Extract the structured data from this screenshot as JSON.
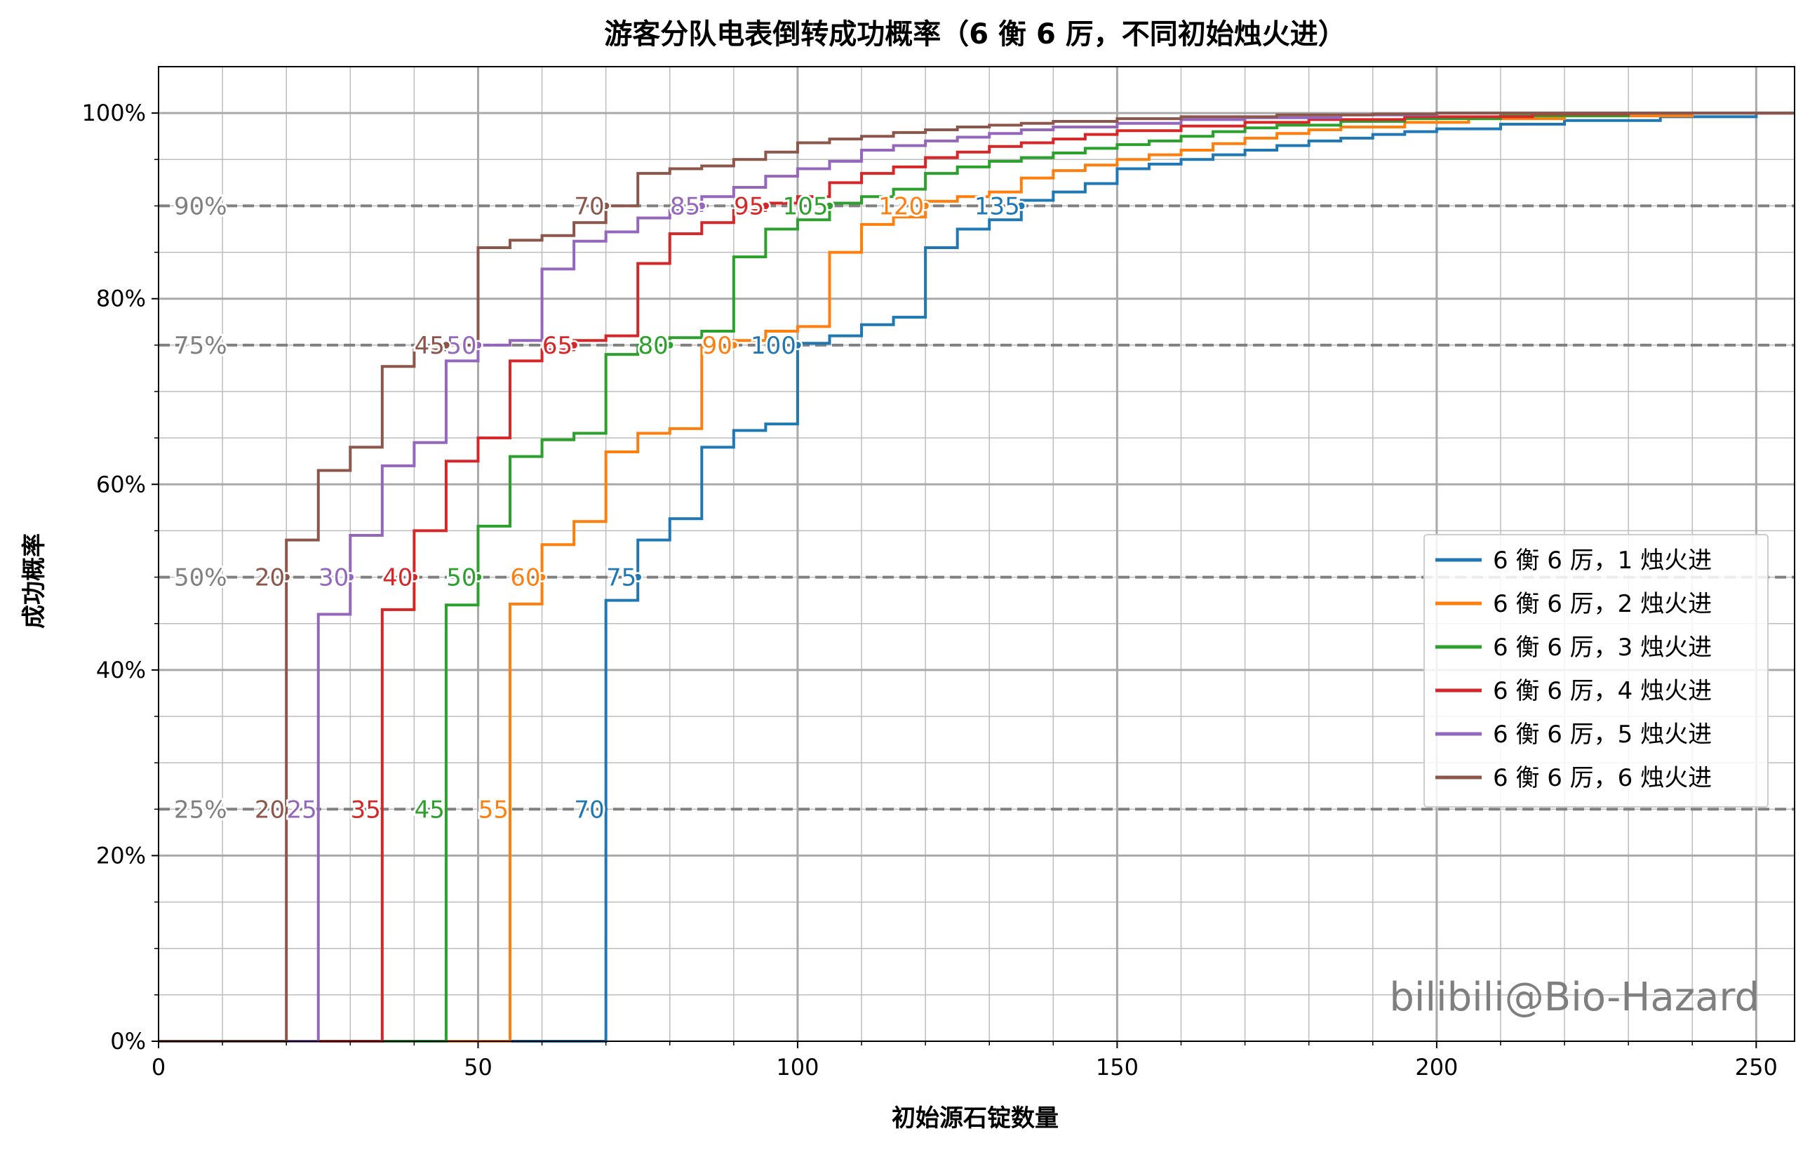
{
  "chart_data": {
    "type": "line",
    "step": "post",
    "title": "游客分队电表倒转成功概率（6 衡 6 厉，不同初始烛火进）",
    "xlabel": "初始源石锭数量",
    "ylabel": "成功概率",
    "xlim": [
      0,
      256
    ],
    "ylim": [
      0,
      1.05
    ],
    "x_ticks": [
      0,
      50,
      100,
      150,
      200,
      250
    ],
    "y_ticks": [
      0,
      0.2,
      0.4,
      0.6,
      0.8,
      1.0
    ],
    "x_tick_labels": [
      "0",
      "50",
      "100",
      "150",
      "200",
      "250"
    ],
    "y_tick_labels": [
      "0%",
      "20%",
      "40%",
      "60%",
      "80%",
      "100%"
    ],
    "grid": true,
    "legend_position": "center-right",
    "reference_lines": [
      {
        "y": 0.25,
        "label": "25%"
      },
      {
        "y": 0.5,
        "label": "50%"
      },
      {
        "y": 0.75,
        "label": "75%"
      },
      {
        "y": 0.9,
        "label": "90%"
      }
    ],
    "series": [
      {
        "name": "6 衡 6 厉，1 烛火进",
        "color": "#1f77b4",
        "steps": [
          [
            0,
            0
          ],
          [
            70,
            0.475
          ],
          [
            75,
            0.54
          ],
          [
            80,
            0.563
          ],
          [
            85,
            0.64
          ],
          [
            90,
            0.658
          ],
          [
            95,
            0.665
          ],
          [
            100,
            0.752
          ],
          [
            105,
            0.76
          ],
          [
            110,
            0.772
          ],
          [
            115,
            0.78
          ],
          [
            120,
            0.855
          ],
          [
            125,
            0.875
          ],
          [
            130,
            0.885
          ],
          [
            135,
            0.906
          ],
          [
            140,
            0.915
          ],
          [
            145,
            0.924
          ],
          [
            150,
            0.94
          ],
          [
            155,
            0.945
          ],
          [
            160,
            0.95
          ],
          [
            165,
            0.955
          ],
          [
            170,
            0.96
          ],
          [
            175,
            0.965
          ],
          [
            180,
            0.97
          ],
          [
            185,
            0.973
          ],
          [
            190,
            0.977
          ],
          [
            195,
            0.98
          ],
          [
            200,
            0.983
          ],
          [
            210,
            0.988
          ],
          [
            220,
            0.992
          ],
          [
            235,
            0.996
          ],
          [
            250,
            1.0
          ],
          [
            256,
            1.0
          ]
        ],
        "markers": [
          {
            "x": 70,
            "y": 0.25,
            "label": "70"
          },
          {
            "x": 75,
            "y": 0.5,
            "label": "75"
          },
          {
            "x": 100,
            "y": 0.75,
            "label": "100"
          },
          {
            "x": 135,
            "y": 0.9,
            "label": "135"
          }
        ]
      },
      {
        "name": "6 衡 6 厉，2 烛火进",
        "color": "#ff7f0e",
        "steps": [
          [
            0,
            0
          ],
          [
            55,
            0.471
          ],
          [
            60,
            0.535
          ],
          [
            65,
            0.56
          ],
          [
            70,
            0.635
          ],
          [
            75,
            0.655
          ],
          [
            80,
            0.66
          ],
          [
            85,
            0.748
          ],
          [
            90,
            0.755
          ],
          [
            95,
            0.765
          ],
          [
            100,
            0.77
          ],
          [
            105,
            0.85
          ],
          [
            110,
            0.88
          ],
          [
            115,
            0.888
          ],
          [
            120,
            0.905
          ],
          [
            125,
            0.91
          ],
          [
            130,
            0.915
          ],
          [
            135,
            0.93
          ],
          [
            140,
            0.938
          ],
          [
            145,
            0.944
          ],
          [
            150,
            0.95
          ],
          [
            155,
            0.955
          ],
          [
            160,
            0.96
          ],
          [
            165,
            0.967
          ],
          [
            170,
            0.973
          ],
          [
            175,
            0.978
          ],
          [
            180,
            0.982
          ],
          [
            185,
            0.985
          ],
          [
            195,
            0.99
          ],
          [
            205,
            0.994
          ],
          [
            220,
            0.997
          ],
          [
            240,
            1.0
          ],
          [
            256,
            1.0
          ]
        ],
        "markers": [
          {
            "x": 55,
            "y": 0.25,
            "label": "55"
          },
          {
            "x": 60,
            "y": 0.5,
            "label": "60"
          },
          {
            "x": 90,
            "y": 0.75,
            "label": "90"
          },
          {
            "x": 120,
            "y": 0.9,
            "label": "120"
          }
        ]
      },
      {
        "name": "6 衡 6 厉，3 烛火进",
        "color": "#2ca02c",
        "steps": [
          [
            0,
            0
          ],
          [
            45,
            0.47
          ],
          [
            50,
            0.555
          ],
          [
            55,
            0.63
          ],
          [
            60,
            0.648
          ],
          [
            65,
            0.655
          ],
          [
            70,
            0.74
          ],
          [
            75,
            0.75
          ],
          [
            80,
            0.758
          ],
          [
            85,
            0.765
          ],
          [
            90,
            0.845
          ],
          [
            95,
            0.875
          ],
          [
            100,
            0.885
          ],
          [
            105,
            0.903
          ],
          [
            110,
            0.91
          ],
          [
            115,
            0.918
          ],
          [
            120,
            0.935
          ],
          [
            125,
            0.942
          ],
          [
            130,
            0.948
          ],
          [
            135,
            0.952
          ],
          [
            140,
            0.957
          ],
          [
            145,
            0.962
          ],
          [
            150,
            0.966
          ],
          [
            155,
            0.97
          ],
          [
            160,
            0.975
          ],
          [
            165,
            0.98
          ],
          [
            170,
            0.984
          ],
          [
            175,
            0.987
          ],
          [
            185,
            0.991
          ],
          [
            195,
            0.994
          ],
          [
            210,
            0.997
          ],
          [
            230,
            1.0
          ],
          [
            256,
            1.0
          ]
        ],
        "markers": [
          {
            "x": 45,
            "y": 0.25,
            "label": "45"
          },
          {
            "x": 50,
            "y": 0.5,
            "label": "50"
          },
          {
            "x": 80,
            "y": 0.75,
            "label": "80"
          },
          {
            "x": 105,
            "y": 0.9,
            "label": "105"
          }
        ]
      },
      {
        "name": "6 衡 6 厉，4 烛火进",
        "color": "#d62728",
        "steps": [
          [
            0,
            0
          ],
          [
            35,
            0.465
          ],
          [
            40,
            0.55
          ],
          [
            45,
            0.625
          ],
          [
            50,
            0.65
          ],
          [
            55,
            0.733
          ],
          [
            60,
            0.745
          ],
          [
            65,
            0.755
          ],
          [
            70,
            0.76
          ],
          [
            75,
            0.838
          ],
          [
            80,
            0.87
          ],
          [
            85,
            0.882
          ],
          [
            90,
            0.895
          ],
          [
            95,
            0.903
          ],
          [
            100,
            0.91
          ],
          [
            105,
            0.925
          ],
          [
            110,
            0.935
          ],
          [
            115,
            0.942
          ],
          [
            120,
            0.952
          ],
          [
            125,
            0.958
          ],
          [
            130,
            0.964
          ],
          [
            135,
            0.968
          ],
          [
            140,
            0.972
          ],
          [
            145,
            0.977
          ],
          [
            150,
            0.981
          ],
          [
            160,
            0.986
          ],
          [
            170,
            0.99
          ],
          [
            180,
            0.993
          ],
          [
            195,
            0.996
          ],
          [
            215,
            0.999
          ],
          [
            230,
            1.0
          ],
          [
            256,
            1.0
          ]
        ],
        "markers": [
          {
            "x": 35,
            "y": 0.25,
            "label": "35"
          },
          {
            "x": 40,
            "y": 0.5,
            "label": "40"
          },
          {
            "x": 65,
            "y": 0.75,
            "label": "65"
          },
          {
            "x": 95,
            "y": 0.9,
            "label": "95"
          }
        ]
      },
      {
        "name": "6 衡 6 厉，5 烛火进",
        "color": "#9467bd",
        "steps": [
          [
            0,
            0
          ],
          [
            25,
            0.46
          ],
          [
            30,
            0.545
          ],
          [
            35,
            0.62
          ],
          [
            40,
            0.645
          ],
          [
            45,
            0.733
          ],
          [
            50,
            0.75
          ],
          [
            55,
            0.755
          ],
          [
            60,
            0.832
          ],
          [
            65,
            0.862
          ],
          [
            70,
            0.872
          ],
          [
            75,
            0.887
          ],
          [
            80,
            0.895
          ],
          [
            85,
            0.91
          ],
          [
            90,
            0.92
          ],
          [
            95,
            0.932
          ],
          [
            100,
            0.94
          ],
          [
            105,
            0.948
          ],
          [
            110,
            0.96
          ],
          [
            115,
            0.965
          ],
          [
            120,
            0.97
          ],
          [
            125,
            0.974
          ],
          [
            130,
            0.978
          ],
          [
            135,
            0.982
          ],
          [
            140,
            0.985
          ],
          [
            150,
            0.989
          ],
          [
            160,
            0.993
          ],
          [
            170,
            0.995
          ],
          [
            185,
            0.998
          ],
          [
            200,
            1.0
          ],
          [
            256,
            1.0
          ]
        ],
        "markers": [
          {
            "x": 25,
            "y": 0.25,
            "label": "25"
          },
          {
            "x": 30,
            "y": 0.5,
            "label": "30"
          },
          {
            "x": 50,
            "y": 0.75,
            "label": "50"
          },
          {
            "x": 85,
            "y": 0.9,
            "label": "85"
          }
        ]
      },
      {
        "name": "6 衡 6 厉，6 烛火进",
        "color": "#8c564b",
        "steps": [
          [
            0,
            0
          ],
          [
            20,
            0.54
          ],
          [
            25,
            0.615
          ],
          [
            30,
            0.64
          ],
          [
            35,
            0.727
          ],
          [
            40,
            0.745
          ],
          [
            45,
            0.75
          ],
          [
            50,
            0.855
          ],
          [
            55,
            0.863
          ],
          [
            60,
            0.868
          ],
          [
            65,
            0.882
          ],
          [
            70,
            0.9
          ],
          [
            75,
            0.935
          ],
          [
            80,
            0.94
          ],
          [
            85,
            0.943
          ],
          [
            90,
            0.95
          ],
          [
            95,
            0.958
          ],
          [
            100,
            0.968
          ],
          [
            105,
            0.972
          ],
          [
            110,
            0.975
          ],
          [
            115,
            0.979
          ],
          [
            120,
            0.982
          ],
          [
            125,
            0.985
          ],
          [
            130,
            0.987
          ],
          [
            135,
            0.989
          ],
          [
            140,
            0.991
          ],
          [
            150,
            0.994
          ],
          [
            160,
            0.996
          ],
          [
            175,
            0.998
          ],
          [
            190,
            0.999
          ],
          [
            200,
            1.0
          ],
          [
            256,
            1.0
          ]
        ],
        "markers": [
          {
            "x": 20,
            "y": 0.25,
            "label": "20"
          },
          {
            "x": 20,
            "y": 0.5,
            "label": "20"
          },
          {
            "x": 45,
            "y": 0.75,
            "label": "45"
          },
          {
            "x": 70,
            "y": 0.9,
            "label": "70"
          }
        ]
      }
    ],
    "watermark": "bilibili@Bio-Hazard"
  }
}
